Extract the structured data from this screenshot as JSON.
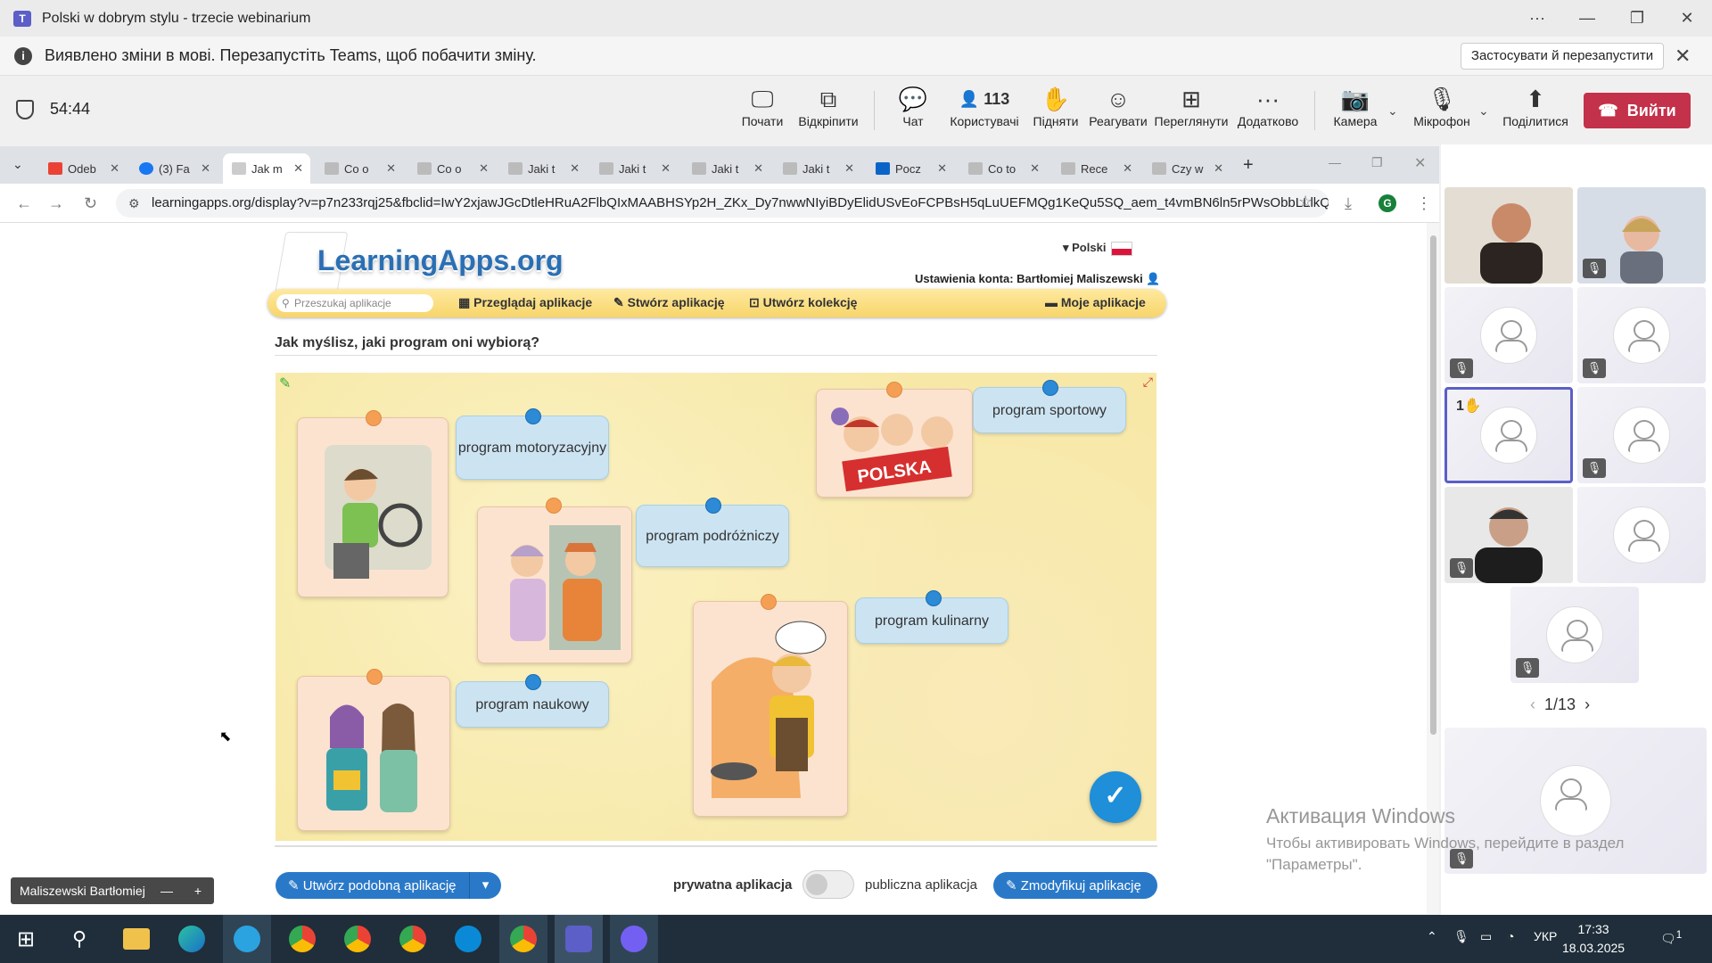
{
  "teams": {
    "title": "Polski w dobrym stylu - trzecie webinarium",
    "notice": "Виявлено зміни в мові. Перезапустіть Teams, щоб побачити зміну.",
    "notice_button": "Застосувати й перезапустити",
    "timer": "54:44",
    "toolbar": {
      "start": "Почати",
      "unpin": "Відкріпити",
      "chat": "Чат",
      "users": "Користувачі",
      "users_count": "113",
      "raise": "Підняти",
      "react": "Реагувати",
      "view": "Переглянути",
      "more": "Додатково",
      "camera": "Камера",
      "mic": "Мікрофон",
      "share": "Поділитися",
      "leave": "Вийти"
    },
    "presenter_name": "Maliszewski Bartłomiej",
    "gallery_pager": "1/13",
    "raised_hand_count": "1"
  },
  "browser": {
    "tabs": [
      "Odeb",
      "(3) Fa",
      "Jak m",
      "Co o",
      "Co o",
      "Jaki t",
      "Jaki t",
      "Jaki t",
      "Jaki t",
      "Pocz",
      "Co to",
      "Rece",
      "Czy w"
    ],
    "url": "learningapps.org/display?v=p7n233rqj25&fbclid=IwY2xjawJGcDtleHRuA2FlbQIxMAABHSYp2H_ZKx_Dy7nwwNIyiBDyElidUSvEoFCPBsH5qLuUEFMQg1KeQu5SQ_aem_t4vmBN6ln5rPWsObbLLlkQ",
    "profile_initial": "G"
  },
  "learningapps": {
    "logo": "LearningApps.org",
    "language": "Polski",
    "account": "Ustawienia konta: Bartłomiej Maliszewski",
    "search_placeholder": "Przeszukaj aplikacje",
    "nav": {
      "browse": "Przeglądaj aplikacje",
      "create": "Stwórz aplikację",
      "collection": "Utwórz kolekcję",
      "mine": "Moje aplikacje"
    },
    "question": "Jak myślisz, jaki program oni wybiorą?",
    "labels": {
      "moto": "program motoryzacyjny",
      "travel": "program podróżniczy",
      "sport": "program sportowy",
      "cooking": "program kulinarny",
      "science": "program naukowy"
    },
    "polska_sign": "POLSKA",
    "bottom": {
      "create_similar": "Utwórz podobną aplikację",
      "private": "prywatna aplikacja",
      "public": "publiczna aplikacja",
      "modify": "Zmodyfikuj aplikację"
    }
  },
  "windows": {
    "activation_title": "Активация Windows",
    "activation_text": "Чтобы активировать Windows, перейдите в раздел \"Параметры\".",
    "language": "УКР",
    "time": "17:33",
    "date": "18.03.2025",
    "notifications": "1"
  }
}
